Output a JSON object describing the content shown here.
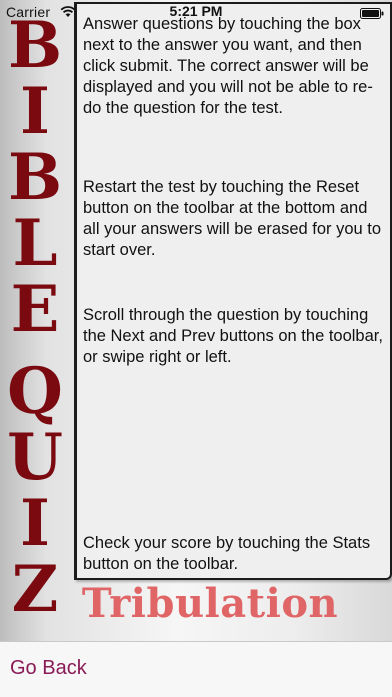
{
  "status_bar": {
    "carrier": "Carrier",
    "time": "5:21 PM",
    "wifi_icon": "wifi-icon",
    "battery_icon": "battery-icon"
  },
  "side_title": {
    "letters": [
      "B",
      "I",
      "B",
      "L",
      "E",
      "Q",
      "U",
      "I",
      "Z"
    ],
    "color": "#7a0a10"
  },
  "instructions": {
    "paragraph_1": "Answer questions by touching the box next to the answer you want, and then click submit.  The correct answer will be displayed and you will not be able to re-do the question  for the test.",
    "paragraph_2": "Restart the test by touching the Reset button on the toolbar at the bottom and all your answers will be erased for you to start over.",
    "paragraph_3": "Scroll through the question by touching the Next and Prev buttons on the toolbar, or swipe right or left.",
    "paragraph_4": "Check your score by touching the Stats button on the toolbar."
  },
  "subtitle": {
    "text": "Tribulation",
    "color": "#e06566"
  },
  "toolbar": {
    "go_back_label": "Go Back",
    "accent_color": "#8a1a55"
  }
}
